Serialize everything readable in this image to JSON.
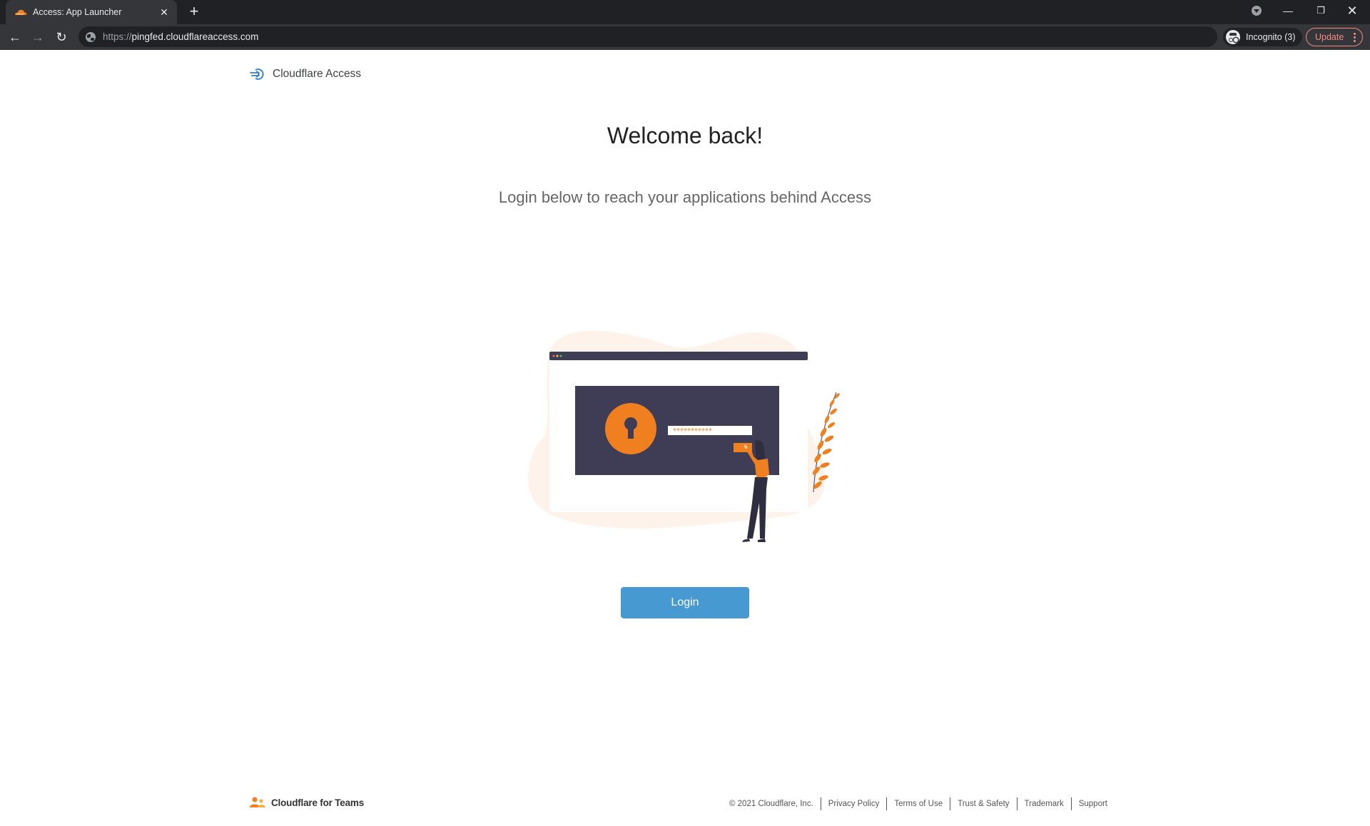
{
  "browser": {
    "tab": {
      "title": "Access: App Launcher",
      "favicon": "cloudflare-cloud-icon"
    },
    "new_tab_label": "+",
    "window_controls": {
      "minimize": "—",
      "maximize": "❐",
      "close": "✕"
    },
    "toolbar": {
      "back": "←",
      "forward": "→",
      "reload": "↻",
      "url_scheme": "https://",
      "url_host": "pingfed.cloudflareaccess.com",
      "incognito_label": "Incognito (3)",
      "update_label": "Update"
    }
  },
  "header": {
    "brand_label": "Cloudflare Access",
    "brand_icon": "access-arrow-icon"
  },
  "main": {
    "title": "Welcome back!",
    "subtitle": "Login below to reach your applications behind Access",
    "illustration": {
      "password_mask": "***********",
      "colors": {
        "accent": "#f0801f",
        "panel": "#3f3d56",
        "blob": "#fdf3ea"
      }
    },
    "login_button": "Login",
    "login_button_color": "#4799d2"
  },
  "footer": {
    "brand_label": "Cloudflare for Teams",
    "copyright": "© 2021 Cloudflare, Inc.",
    "links": [
      "Privacy Policy",
      "Terms of Use",
      "Trust & Safety",
      "Trademark",
      "Support"
    ]
  }
}
